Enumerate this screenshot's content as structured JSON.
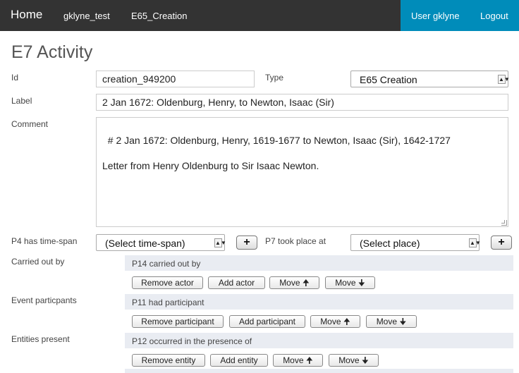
{
  "nav": {
    "home": "Home",
    "collection": "gklyne_test",
    "type_link": "E65_Creation",
    "user": "User gklyne",
    "logout": "Logout"
  },
  "page": {
    "title": "E7 Activity"
  },
  "form": {
    "id_label": "Id",
    "id_value": "creation_949200",
    "type_label": "Type",
    "type_value": "E65 Creation",
    "label_label": "Label",
    "label_value": "2 Jan 1672: Oldenburg, Henry, to Newton, Isaac (Sir)",
    "comment_label": "Comment",
    "comment_value": "# 2 Jan 1672: Oldenburg, Henry, 1619-1677 to Newton, Isaac (Sir), 1642-1727\n\nLetter from Henry Oldenburg to Sir Isaac Newton.",
    "timespan_label": "P4 has time-span",
    "timespan_value": "(Select time-span)",
    "place_label": "P7 took place at",
    "place_value": "(Select place)",
    "plus": "+",
    "select_arrow": "▲▼"
  },
  "groups": {
    "carried": {
      "label": "Carried out by",
      "header": "P14 carried out by",
      "remove": "Remove actor",
      "add": "Add actor",
      "up": "Move 🠉",
      "down": "Move 🠋"
    },
    "participants": {
      "label": "Event particpants",
      "header": "P11 had participant",
      "remove": "Remove participant",
      "add": "Add participant",
      "up": "Move 🠉",
      "down": "Move 🠋"
    },
    "entities": {
      "label": "Entities present",
      "header": "P12 occurred in the presence of",
      "remove": "Remove entity",
      "add": "Add entity",
      "up": "Move 🠉",
      "down": "Move 🠋"
    }
  }
}
